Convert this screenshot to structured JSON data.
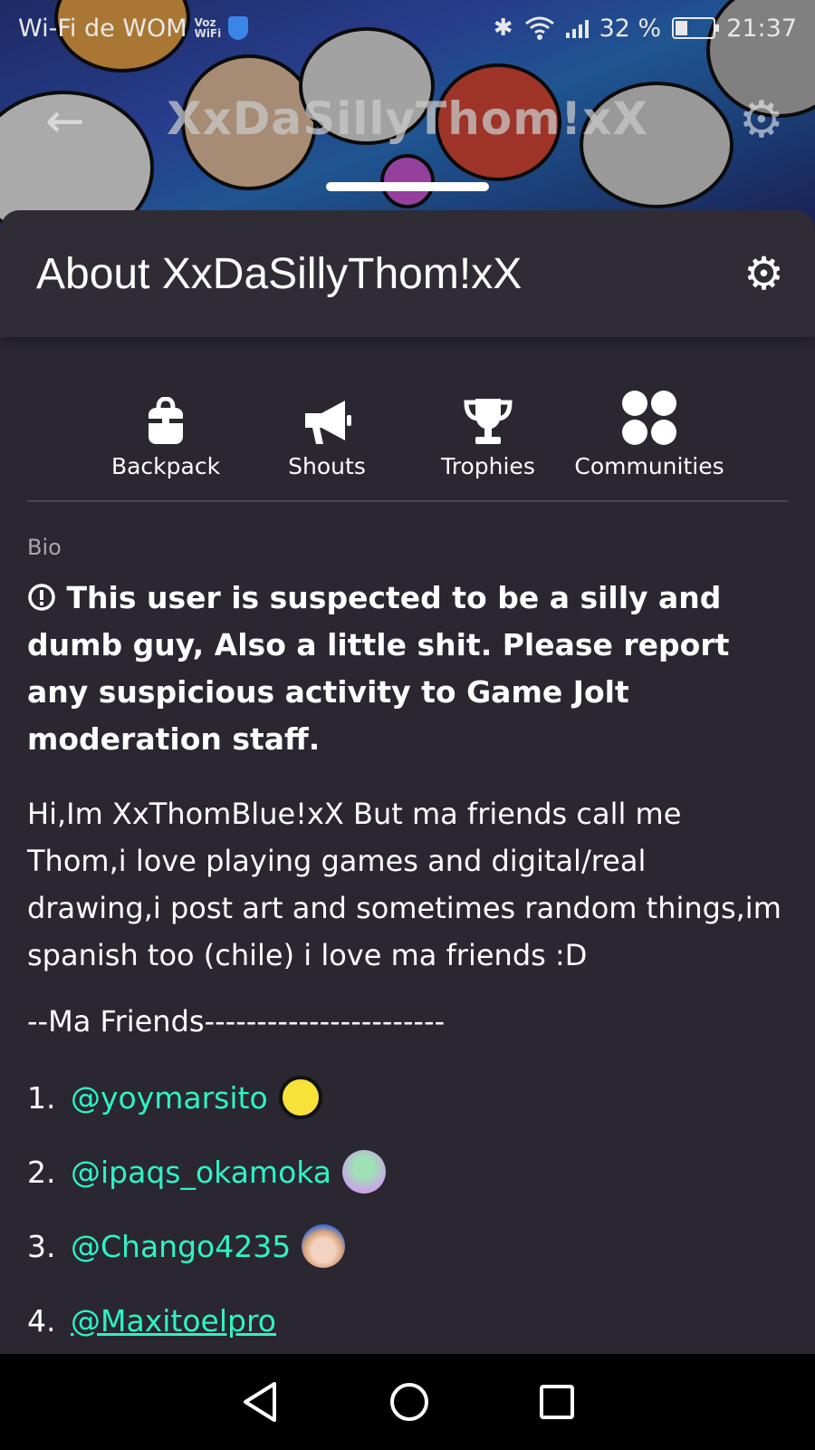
{
  "status_bar": {
    "network": "Wi-Fi de WOM",
    "voz": "Voz",
    "wifi": "WiFi",
    "battery": "32 %",
    "battery_level_pct": 32,
    "time": "21:37"
  },
  "banner": {
    "title": "XxDaSillyThom!xX",
    "back_icon": "arrow-left-icon",
    "settings_icon": "gear-icon"
  },
  "sheet": {
    "title": "About XxDaSillyThom!xX",
    "settings_icon": "gear-icon"
  },
  "actions": [
    {
      "label": "Backpack",
      "icon": "backpack-icon"
    },
    {
      "label": "Shouts",
      "icon": "megaphone-icon"
    },
    {
      "label": "Trophies",
      "icon": "trophy-icon"
    },
    {
      "label": "Communities",
      "icon": "communities-icon"
    }
  ],
  "bio": {
    "label": "Bio",
    "warning": "This user is suspected to be a silly and dumb guy, Also a little shit. Please report any suspicious activity to Game Jolt moderation staff.",
    "paragraph": "Hi,Im XxThomBlue!xX But ma friends call me Thom,i love playing games and digital/real drawing,i post art and sometimes random things,im spanish too (chile) i love ma friends :D",
    "friends_heading": "--Ma Friends-----------------------",
    "friends": [
      {
        "num": "1.",
        "handle": "@yoymarsito",
        "avatar_color": "#f7e23a"
      },
      {
        "num": "2.",
        "handle": "@ipaqs_okamoka",
        "avatar_color": "#c9a6e6"
      },
      {
        "num": "3.",
        "handle": "@Chango4235",
        "avatar_color": "#d8a37a"
      },
      {
        "num": "4.",
        "handle": "@Maxitoelpro",
        "avatar_color": ""
      }
    ]
  },
  "colors": {
    "sheet_bg": "#2a2731",
    "mention": "#2ff3c4"
  }
}
